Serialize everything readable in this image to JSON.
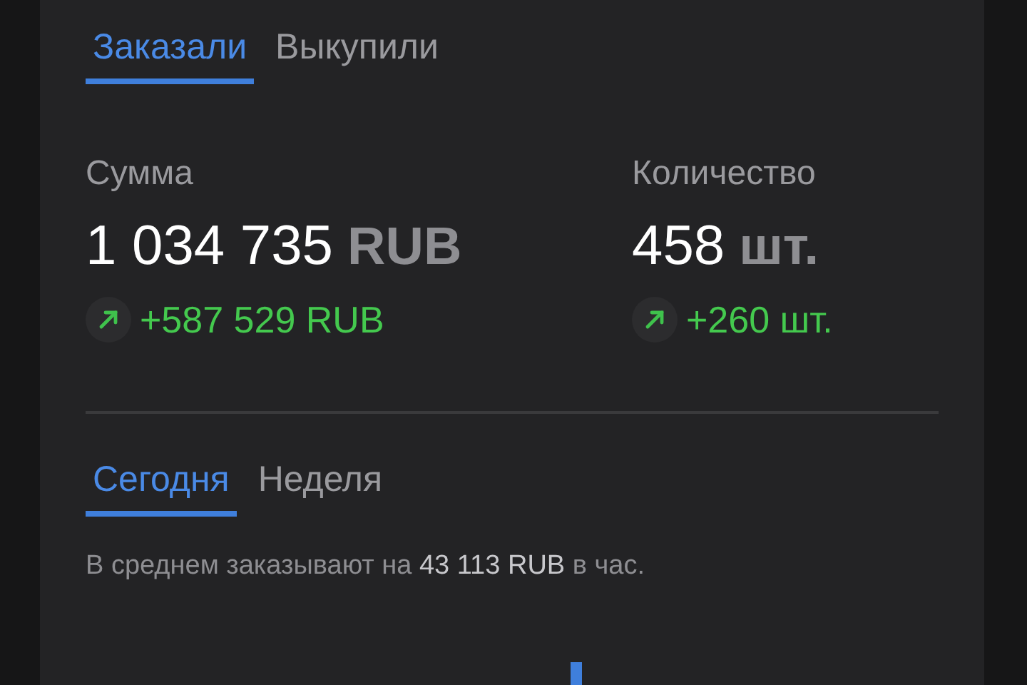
{
  "top_tabs": [
    {
      "label": "Заказали",
      "selected": true
    },
    {
      "label": "Выкупили",
      "selected": false
    }
  ],
  "metrics": [
    {
      "label": "Сумма",
      "value": "1 034 735",
      "unit": "RUB",
      "change": "+587 529 RUB",
      "kind": "up"
    },
    {
      "label": "Количество",
      "value": "458",
      "unit": "шт.",
      "change": "+260 шт.",
      "kind": "up"
    }
  ],
  "period_tabs": [
    {
      "label": "Сегодня",
      "selected": true
    },
    {
      "label": "Неделя",
      "selected": false
    }
  ],
  "summary": "В среднем заказывают на **43 113 RUB** в час."
}
